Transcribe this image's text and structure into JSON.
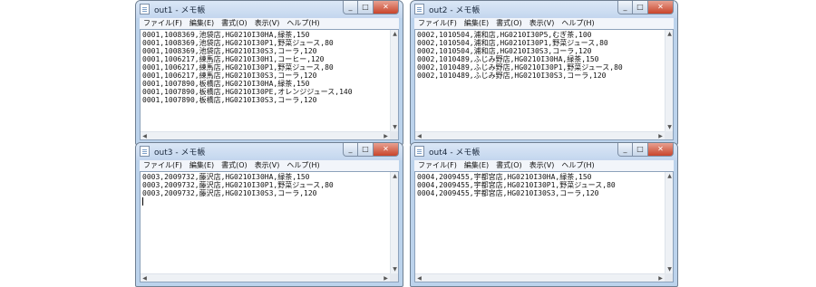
{
  "windows": [
    {
      "title": "out1 - メモ帳",
      "menu": [
        "ファイル(F)",
        "編集(E)",
        "書式(O)",
        "表示(V)",
        "ヘルプ(H)"
      ],
      "text": "0001,1008369,池袋店,HG0210I30HA,緑茶,150\n0001,1008369,池袋店,HG0210I30P1,野菜ジュース,80\n0001,1008369,池袋店,HG0210I30S3,コーラ,120\n0001,1006217,練馬店,HG0210I30H1,コーヒー,120\n0001,1006217,練馬店,HG0210I30P1,野菜ジュース,80\n0001,1006217,練馬店,HG0210I30S3,コーラ,120\n0001,1007890,板橋店,HG0210I30HA,緑茶,150\n0001,1007890,板橋店,HG0210I30PE,オレンジジュース,140\n0001,1007890,板橋店,HG0210I30S3,コーラ,120"
    },
    {
      "title": "out2 - メモ帳",
      "menu": [
        "ファイル(F)",
        "編集(E)",
        "書式(O)",
        "表示(V)",
        "ヘルプ(H)"
      ],
      "text": "0002,1010504,浦和店,HG0210I30P5,むぎ茶,100\n0002,1010504,浦和店,HG0210I30P1,野菜ジュース,80\n0002,1010504,浦和店,HG0210I30S3,コーラ,120\n0002,1010489,ふじみ野店,HG0210I30HA,緑茶,150\n0002,1010489,ふじみ野店,HG0210I30P1,野菜ジュース,80\n0002,1010489,ふじみ野店,HG0210I30S3,コーラ,120"
    },
    {
      "title": "out3 - メモ帳",
      "menu": [
        "ファイル(F)",
        "編集(E)",
        "書式(O)",
        "表示(V)",
        "ヘルプ(H)"
      ],
      "text": "0003,2009732,藤沢店,HG0210I30HA,緑茶,150\n0003,2009732,藤沢店,HG0210I30P1,野菜ジュース,80\n0003,2009732,藤沢店,HG0210I30S3,コーラ,120"
    },
    {
      "title": "out4 - メモ帳",
      "menu": [
        "ファイル(F)",
        "編集(E)",
        "書式(O)",
        "表示(V)",
        "ヘルプ(H)"
      ],
      "text": "0004,2009455,宇都宮店,HG0210I30HA,緑茶,150\n0004,2009455,宇都宮店,HG0210I30P1,野菜ジュース,80\n0004,2009455,宇都宮店,HG0210I30S3,コーラ,120"
    }
  ]
}
